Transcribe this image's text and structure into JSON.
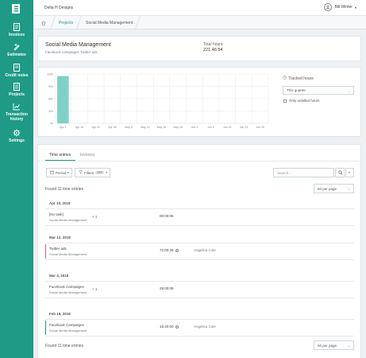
{
  "sidebar": {
    "items": [
      {
        "label": "Invoices",
        "icon": "invoice-icon"
      },
      {
        "label": "Estimates",
        "icon": "estimates-icon"
      },
      {
        "label": "Credit notes",
        "icon": "credit-notes-icon"
      },
      {
        "label": "Projects",
        "icon": "projects-icon"
      },
      {
        "label": "Transaction history",
        "icon": "transaction-history-icon"
      },
      {
        "label": "Settings",
        "icon": "settings-icon"
      }
    ],
    "color": "#1f9a87"
  },
  "topbar": {
    "company": "Delta H Designs",
    "user": "Bill Winter"
  },
  "breadcrumb": {
    "items": [
      "Projects",
      "Social Media Management"
    ]
  },
  "project": {
    "title": "Social Media Management",
    "subtitle": "Facebook campaigns Twitter ads",
    "total_label": "Total hours",
    "total_value": "221:46:54"
  },
  "chart_controls": {
    "tracked_label": "Tracked hours",
    "period_value": "This quarter",
    "unbilled_label": "Only unbilled hours"
  },
  "chart_data": {
    "type": "bar",
    "categories": [
      "Apr 1",
      "Apr 14",
      "Apr 21",
      "Apr 28",
      "May 5",
      "May 12",
      "May 19",
      "May 26",
      "Jun 2",
      "Jun 9",
      "Jun 16",
      "Jun 23",
      "Jun 30"
    ],
    "series": [
      {
        "values": [
          115,
          0,
          0,
          0,
          0,
          0,
          0,
          0,
          0,
          0,
          0,
          0,
          0
        ]
      }
    ],
    "y_ticks": [
      "0h",
      "30h",
      "60h",
      "90h",
      "120h"
    ],
    "ylim": [
      0,
      120
    ],
    "bar_color": "#7fd1c6",
    "grid": true
  },
  "tabs": [
    {
      "label": "Time entries",
      "active": true
    },
    {
      "label": "Invoices",
      "active": false
    }
  ],
  "toolbar": {
    "period_label": "Period",
    "filters_label": "Filters",
    "filters_badge": "OFF",
    "search_placeholder": "Search..."
  },
  "found_text": "Found 11 time entries",
  "per_page": "50 per page",
  "groups": [
    {
      "date": "Apr 10, 2018",
      "entries": [
        {
          "task": "[No task]",
          "project": "Social Media Management",
          "plus": "+ 1",
          "duration": "00:00:05",
          "info": false,
          "person": "",
          "bar_color": "#ffffff"
        }
      ]
    },
    {
      "date": "Mar 12, 2018",
      "entries": [
        {
          "task": "Twitter ads",
          "project": "Social Media Management",
          "plus": "",
          "duration": "72:00:26",
          "info": true,
          "person": "Angelica Cole",
          "bar_color": "#d45b84"
        }
      ]
    },
    {
      "date": "Mar 4, 2018",
      "entries": [
        {
          "task": "Facebook Campaigns",
          "project": "Social Media Management",
          "plus": "+ 1",
          "duration": "29:00:09",
          "info": false,
          "person": "",
          "bar_color": "#ffffff"
        }
      ]
    },
    {
      "date": "Feb 19, 2018",
      "entries": [
        {
          "task": "Facebook Campaigns",
          "project": "Social Media Management",
          "plus": "",
          "duration": "15:40:00",
          "info": true,
          "person": "Angelica Cole",
          "bar_color": "#1f9a87"
        }
      ]
    }
  ]
}
